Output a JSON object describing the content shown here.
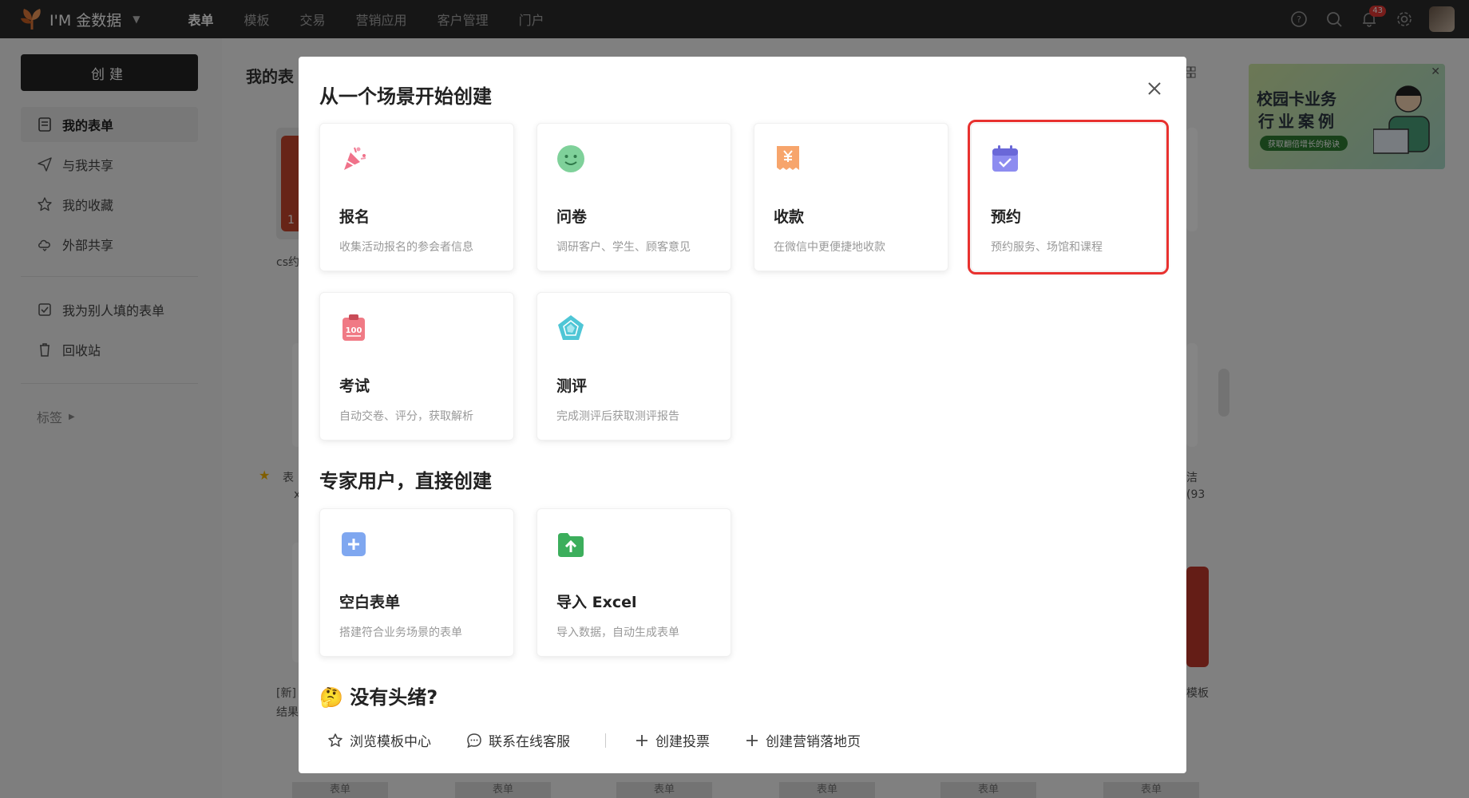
{
  "app": {
    "brand": "I'M 金数据",
    "nav": [
      "表单",
      "模板",
      "交易",
      "营销应用",
      "客户管理",
      "门户"
    ],
    "notification_count": "43"
  },
  "sidebar": {
    "create_label": "创建",
    "items": [
      "我的表单",
      "与我共享",
      "我的收藏",
      "外部共享"
    ],
    "items2": [
      "我为别人填的表单",
      "回收站"
    ],
    "tags_label": "标签"
  },
  "main": {
    "title": "我的表",
    "peek": {
      "a": "cs约",
      "b": "表",
      "c": "x",
      "d": "[新]",
      "e": "结果",
      "f": "洁",
      "g": "(93",
      "h": "模板",
      "card_num": "1"
    },
    "strip_label": "表单"
  },
  "ad": {
    "line1": "校园卡业务",
    "line2": "行业案例",
    "pill": "获取翻倍增长的秘诀"
  },
  "modal": {
    "title": "从一个场景开始创建",
    "scenes": [
      {
        "title": "报名",
        "desc": "收集活动报名的参会者信息",
        "icon": "party-popper-icon"
      },
      {
        "title": "问卷",
        "desc": "调研客户、学生、顾客意见",
        "icon": "smiley-icon"
      },
      {
        "title": "收款",
        "desc": "在微信中更便捷地收款",
        "icon": "receipt-yen-icon"
      },
      {
        "title": "预约",
        "desc": "预约服务、场馆和课程",
        "icon": "calendar-check-icon"
      },
      {
        "title": "考试",
        "desc": "自动交卷、评分，获取解析",
        "icon": "exam-clipboard-icon"
      },
      {
        "title": "测评",
        "desc": "完成测评后获取测评报告",
        "icon": "pentagon-chart-icon"
      }
    ],
    "expert_title": "专家用户，直接创建",
    "expert": [
      {
        "title": "空白表单",
        "desc": "搭建符合业务场景的表单",
        "icon": "plus-square-icon"
      },
      {
        "title": "导入 Excel",
        "desc": "导入数据，自动生成表单",
        "icon": "upload-folder-icon"
      }
    ],
    "idea_emoji": "🤔",
    "idea_title": "没有头绪?",
    "links": [
      "浏览模板中心",
      "联系在线客服",
      "创建投票",
      "创建营销落地页"
    ]
  }
}
